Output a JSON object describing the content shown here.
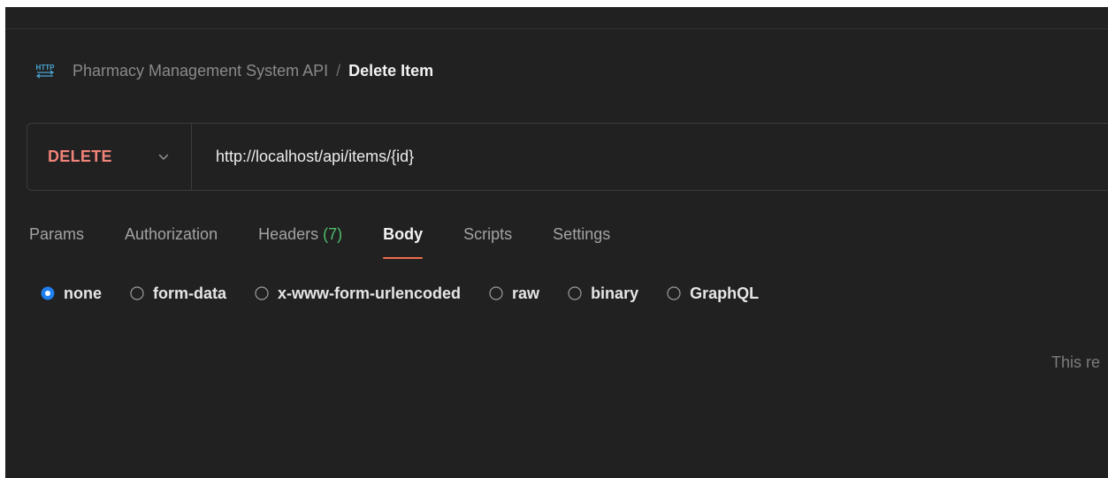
{
  "breadcrumb": {
    "icon": "http-icon",
    "collection": "Pharmacy Management System API",
    "separator": "/",
    "current": "Delete Item"
  },
  "request": {
    "method": "DELETE",
    "url": "http://localhost/api/items/{id}"
  },
  "tabs": [
    {
      "label": "Params",
      "active": false
    },
    {
      "label": "Authorization",
      "active": false
    },
    {
      "label": "Headers",
      "count": "(7)",
      "active": false
    },
    {
      "label": "Body",
      "active": true
    },
    {
      "label": "Scripts",
      "active": false
    },
    {
      "label": "Settings",
      "active": false
    }
  ],
  "body_options": [
    {
      "label": "none",
      "selected": true
    },
    {
      "label": "form-data",
      "selected": false
    },
    {
      "label": "x-www-form-urlencoded",
      "selected": false
    },
    {
      "label": "raw",
      "selected": false
    },
    {
      "label": "binary",
      "selected": false
    },
    {
      "label": "GraphQL",
      "selected": false
    }
  ],
  "empty_message": "This re",
  "colors": {
    "background": "#212121",
    "method_delete": "#f0837a",
    "tab_underline": "#f06c4d",
    "headers_count": "#4ebd6b",
    "radio_selected": "#1f7ff0"
  }
}
